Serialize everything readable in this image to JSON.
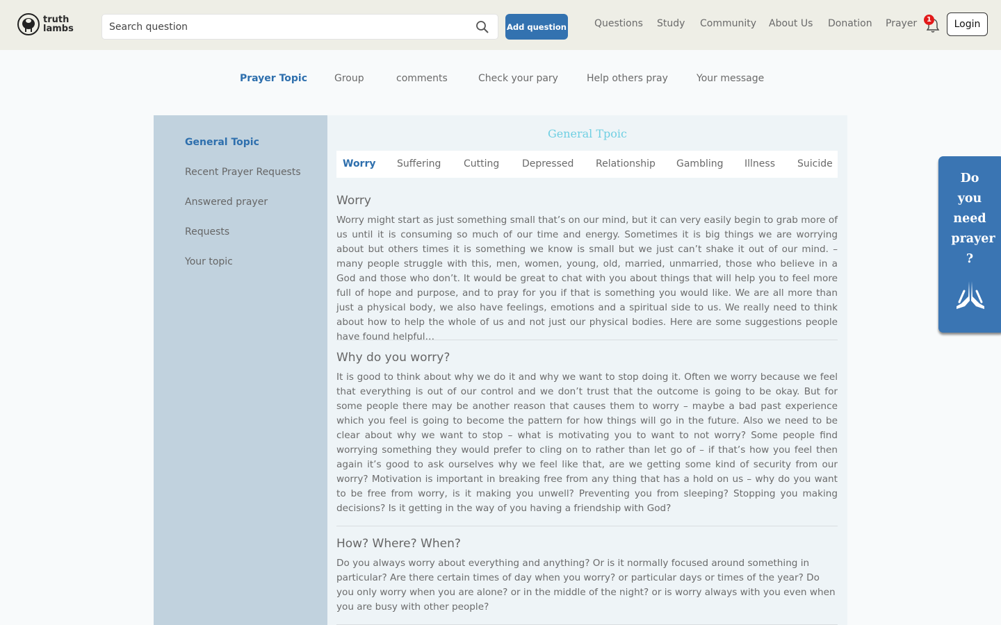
{
  "header": {
    "logo_line1": "truth",
    "logo_line2": "lambs",
    "search_placeholder": "Search question",
    "add_question": "Add question",
    "nav": [
      "Questions",
      "Study",
      "Community",
      "About Us",
      "Donation",
      "Prayer"
    ],
    "notification_count": "1",
    "login": "Login"
  },
  "subnav": [
    "Prayer Topic",
    "Group",
    "comments",
    "Check your pary",
    "Help others pray",
    "Your message"
  ],
  "sidebar": [
    "General Topic",
    "Recent Prayer Requests",
    "Answered prayer",
    "Requests",
    "Your topic"
  ],
  "content": {
    "title": "General Tpoic",
    "tabs": [
      "Worry",
      "Suffering",
      "Cutting",
      "Depressed",
      "Relationship",
      "Gambling",
      "Illness",
      "Suicide"
    ],
    "sections": [
      {
        "title": "Worry",
        "body": "Worry might start as just something small that’s on our mind, but it can very easily begin to grab more of us until it is consuming so much of our time and energy. Sometimes it is big things we are worrying about but others times it is something we know is small but we just can’t shake it out of our mind. – many people struggle with this, men, women, young, old, married, unmarried, those who believe in a God and those who don’t. It would be great to chat with you about things that will help you to feel more full of hope and purpose, and to pray for you if that is something you would like. We are all more than just a physical body, we also have feelings, emotions and a spiritual side to us. We really need to think about how to help the whole of us and not just our physical bodies. Here are some suggestions people have found helpful…"
      },
      {
        "title": "Why do you worry?",
        "body": "It is good to think about why we do it and why we want to stop doing it. Often we worry because we feel that everything is out of our control and we don’t trust that the outcome is going to be okay. But for some people there may be another reason that causes them to worry – maybe a bad past experience which you feel is going to become the pattern for how things will go in the future. Also we need to be clear about why we want to stop – what is motivating you to want to not worry? Some people find worrying something they would prefer to cling on to rather than let go of – if that’s how you feel then again it’s good to ask ourselves why we feel like that, are we getting some kind of security from our worry? Motivation is important in breaking free from any thing that has a hold on us – why do you want to be free from worry, is it making you unwell? Preventing you from sleeping? Stopping you making decisions? Is it getting in the way of you having a friendship with God?"
      },
      {
        "title": "How? Where? When?",
        "body": "Do you always worry about everything and anything? Or is it normally focused around something in particular? Are there certain times of day when you worry? or particular days or times of the year? Do you only worry when you are alone? or in the middle of the night? or is worry always with you even when you are busy with other people?"
      }
    ]
  },
  "prayer_card": {
    "lines": [
      "Do",
      "you",
      "need",
      "prayer",
      "?"
    ]
  },
  "colors": {
    "accent": "#2e6fad",
    "button": "#3372b0",
    "sidebar": "#c1d2de",
    "title": "#6fcfe2"
  }
}
